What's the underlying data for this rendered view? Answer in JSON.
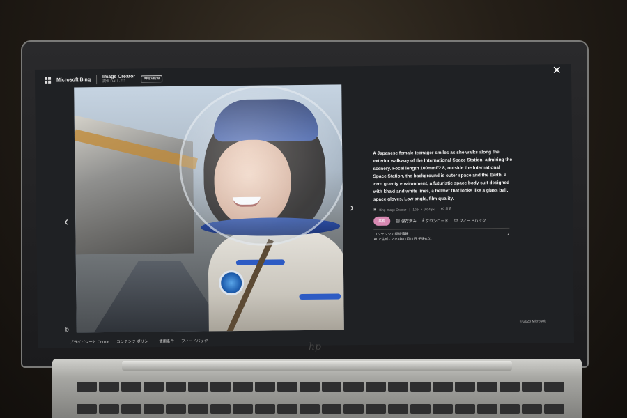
{
  "topbar": {
    "brand": "Microsoft Bing",
    "product": "Image Creator",
    "product_sub": "提供 DALL·E 3",
    "badge": "PREVIEW",
    "close_glyph": "✕"
  },
  "nav": {
    "prev_glyph": "‹",
    "next_glyph": "›"
  },
  "prompt": "A Japanese female teenager smiles as she walks along the exterior walkway of the International Space Station, admiring the scenery. Focal length 100mmf/2.8, outside the International Space Station, the background is outer space and the Earth, a zero gravity environment, a futuristic space body suit designed with khaki and white lines, a helmet that looks like a glass ball, space gloves, Low angle, film quality.",
  "meta": {
    "source": "Bing Image Creator",
    "size": "1024 × 1024 px",
    "time": "60 分前"
  },
  "actions": {
    "share": "共有",
    "save": "保存済み",
    "download": "ダウンロード",
    "feedback": "フィードバック"
  },
  "credential": {
    "title": "コンテンツの認証情報",
    "detail": "AI で生成 · 2023年11月11日 午後6:01",
    "info_glyph": "●"
  },
  "copyright": "© 2023 Microsoft",
  "footer": [
    "プライバシーと Cookie",
    "コンテンツ ポリシー",
    "使用条件",
    "フィードバック"
  ],
  "bing_mark": "b",
  "hp_logo": "hp"
}
